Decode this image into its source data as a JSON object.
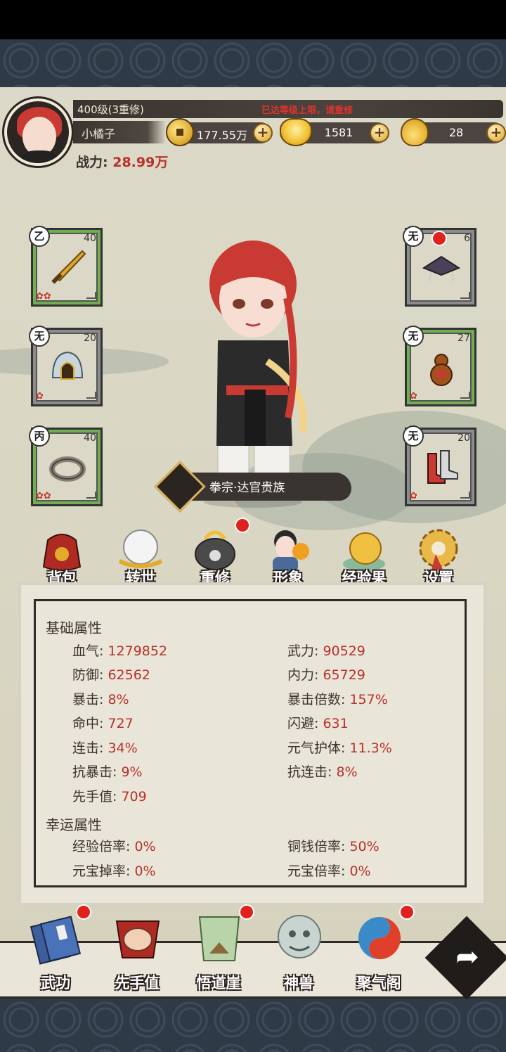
{
  "player": {
    "level_text": "400级(3重修)",
    "level_warning": "已达等级上限，请重修",
    "name": "小橘子",
    "power_label": "战力:",
    "power_value": "28.99万"
  },
  "resources": [
    {
      "name": "copper-coin",
      "value": "177.55万"
    },
    {
      "name": "gold-ingot",
      "value": "1581"
    },
    {
      "name": "gourd",
      "value": "28"
    }
  ],
  "equipment": {
    "left": [
      {
        "grade": "乙",
        "level": "40",
        "item": "sword-icon",
        "gems": "✿✿",
        "frame": "green"
      },
      {
        "grade": "无",
        "level": "20",
        "item": "helmet-icon",
        "gems": "✿",
        "frame": "gray"
      },
      {
        "grade": "丙",
        "level": "40",
        "item": "ring-icon",
        "gems": "✿✿",
        "frame": "green"
      }
    ],
    "right": [
      {
        "grade": "无",
        "level": "6",
        "item": "hat-icon",
        "gems": "",
        "frame": "gray"
      },
      {
        "grade": "无",
        "level": "27",
        "item": "gourd-icon",
        "gems": "✿",
        "frame": "green"
      },
      {
        "grade": "无",
        "level": "20",
        "item": "boots-icon",
        "gems": "✿",
        "frame": "gray"
      }
    ]
  },
  "character_title": "拳宗·达官贵族",
  "menu": [
    {
      "label": "背包",
      "icon": "bag-icon"
    },
    {
      "label": "转世",
      "icon": "pearl-icon"
    },
    {
      "label": "重修",
      "icon": "cauldron-icon"
    },
    {
      "label": "形象",
      "icon": "portrait-icon"
    },
    {
      "label": "经验果",
      "icon": "fruit-icon"
    },
    {
      "label": "设置",
      "icon": "gear-icon"
    }
  ],
  "stats": {
    "basic_title": "基础属性",
    "basic": [
      {
        "label": "血气:",
        "value": "1279852"
      },
      {
        "label": "武力:",
        "value": "90529"
      },
      {
        "label": "防御:",
        "value": "62562"
      },
      {
        "label": "内力:",
        "value": "65729"
      },
      {
        "label": "暴击:",
        "value": "8%"
      },
      {
        "label": "暴击倍数:",
        "value": "157%"
      },
      {
        "label": "命中:",
        "value": "727"
      },
      {
        "label": "闪避:",
        "value": "631"
      },
      {
        "label": "连击:",
        "value": "34%"
      },
      {
        "label": "元气护体:",
        "value": "11.3%"
      },
      {
        "label": "抗暴击:",
        "value": "9%"
      },
      {
        "label": "抗连击:",
        "value": "8%"
      },
      {
        "label": "先手值:",
        "value": "709"
      }
    ],
    "luck_title": "幸运属性",
    "luck": [
      {
        "label": "经验倍率:",
        "value": "0%"
      },
      {
        "label": "铜钱倍率:",
        "value": "50%"
      },
      {
        "label": "元宝掉率:",
        "value": "0%"
      },
      {
        "label": "元宝倍率:",
        "value": "0%"
      }
    ]
  },
  "nav": [
    {
      "label": "武功",
      "icon": "book-icon"
    },
    {
      "label": "先手值",
      "icon": "fist-icon"
    },
    {
      "label": "悟道崖",
      "icon": "cliff-icon"
    },
    {
      "label": "神兽",
      "icon": "beast-icon"
    },
    {
      "label": "聚气阁",
      "icon": "swirl-icon"
    }
  ],
  "colors": {
    "accent_red": "#b8322b",
    "warning_red": "#e0322d",
    "frame_green": "#6fae52",
    "frame_gray": "#8c8c8c"
  }
}
